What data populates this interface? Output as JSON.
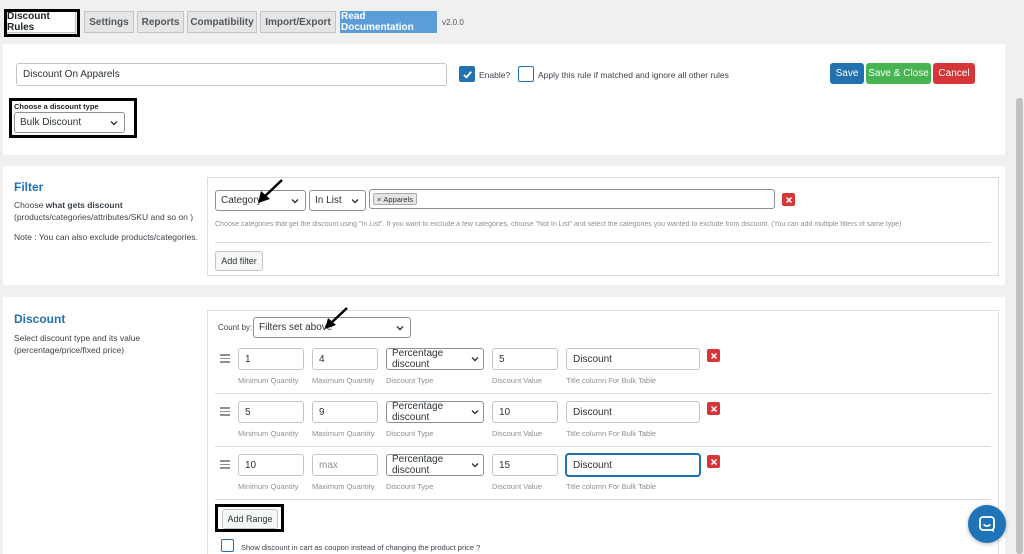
{
  "tabs": [
    {
      "label": "Discount Rules"
    },
    {
      "label": "Settings"
    },
    {
      "label": "Reports"
    },
    {
      "label": "Compatibility"
    },
    {
      "label": "Import/Export"
    },
    {
      "label": "Read Documentation"
    }
  ],
  "version": "v2.0.0",
  "rule": {
    "name_value": "Discount On Apparels",
    "enable_label": "Enable?",
    "enable_checked": true,
    "exclusive_label": "Apply this rule if matched and ignore all other rules",
    "exclusive_checked": false,
    "discount_type_label": "Choose a discount type",
    "discount_type_value": "Bulk Discount"
  },
  "actions": {
    "save": "Save",
    "save_close": "Save & Close",
    "cancel": "Cancel"
  },
  "filter": {
    "title": "Filter",
    "desc_prefix": "Choose ",
    "desc_bold": "what gets discount",
    "desc_line2": "(products/categories/attributes/SKU and so on )",
    "note": "Note : You can also exclude products/categories.",
    "type_value": "Category",
    "operator_value": "In List",
    "tag": "Apparels",
    "help": "Choose categories that get the discount using \"In List\". If you want to exclude a few categories, choose \"Not In List\" and select the categories you wanted to exclude from discount. (You can add multiple filters of same type)",
    "add_filter": "Add filter"
  },
  "discount": {
    "title": "Discount",
    "desc_line1": "Select discount type and its value",
    "desc_line2": "(percentage/price/fixed price)",
    "count_by_label": "Count by:",
    "count_by_value": "Filters set above",
    "labels": {
      "min": "Minimum Quantity",
      "max": "Maximum Quantity",
      "type": "Discount Type",
      "value": "Discount Value",
      "title": "Title column For Bulk Table"
    },
    "ranges": [
      {
        "min": "1",
        "max": "4",
        "type": "Percentage discount",
        "value": "5",
        "title": "Discount"
      },
      {
        "min": "5",
        "max": "9",
        "type": "Percentage discount",
        "value": "10",
        "title": "Discount"
      },
      {
        "min": "10",
        "max": "max",
        "type": "Percentage discount",
        "value": "15",
        "title": "Discount"
      }
    ],
    "add_range": "Add Range",
    "coupon_label": "Show discount in cart as coupon instead of changing the product price ?"
  }
}
